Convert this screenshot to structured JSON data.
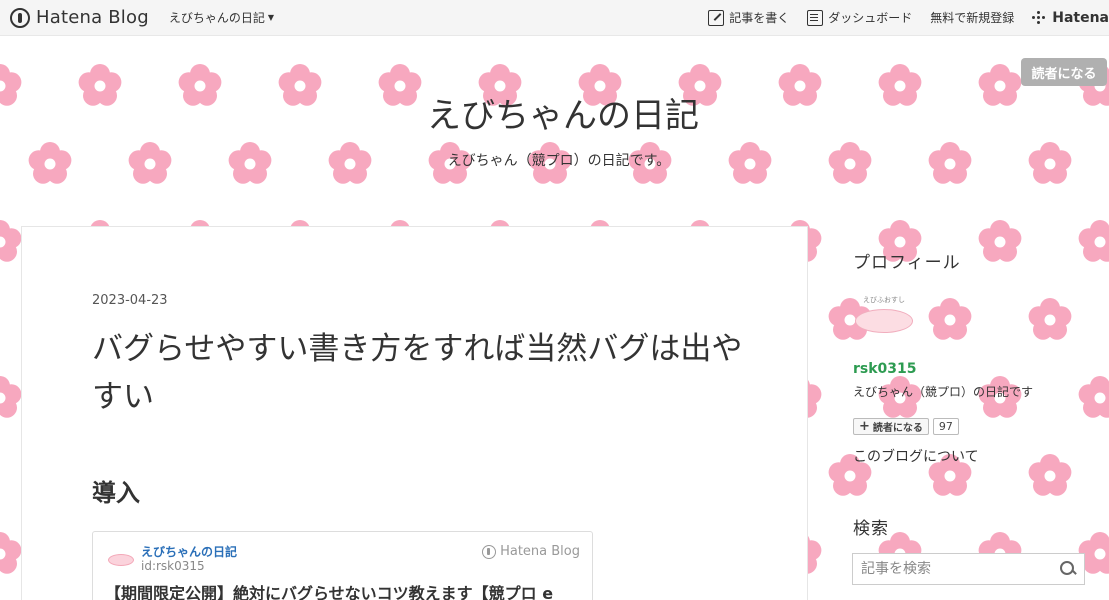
{
  "topbar": {
    "brand": "Hatena Blog",
    "blog_menu": "えびちゃんの日記",
    "write_post": "記事を書く",
    "dashboard": "ダッシュボード",
    "signup": "無料で新規登録",
    "hatena": "Hatena"
  },
  "header": {
    "subscribe": "読者になる",
    "title": "えびちゃんの日記",
    "description": "えびちゃん（競プロ）の日記です。"
  },
  "post": {
    "date": "2023-04-23",
    "title": "バグらせやすい書き方をすれば当然バグは出やすい",
    "section_heading": "導入",
    "embed": {
      "blog_name": "えびちゃんの日記",
      "user_id": "id:rsk0315",
      "provider": "Hatena Blog",
      "title": "【期間限定公開】絶対にバグらせないコツ教えます【競プロ e"
    }
  },
  "sidebar": {
    "profile_heading": "プロフィール",
    "profile_icon_label": "えびふおすし",
    "profile_name": "rsk0315",
    "profile_desc": "えびちゃん（競プロ）の日記です",
    "reader_button": "読者になる",
    "reader_count": "97",
    "about_link": "このブログについて",
    "search_heading": "検索",
    "search_placeholder": "記事を検索"
  },
  "icons": {
    "brand": "hatena-drop-icon",
    "write": "pencil-icon",
    "dashboard": "dashboard-icon",
    "hatena": "hatena-dots-icon",
    "search": "search-icon"
  },
  "colors": {
    "flower": "#f7a8bf",
    "profile_name": "#2d9b51",
    "embed_link": "#2a6fb8",
    "subscribe_bg": "#b0b0b0"
  }
}
